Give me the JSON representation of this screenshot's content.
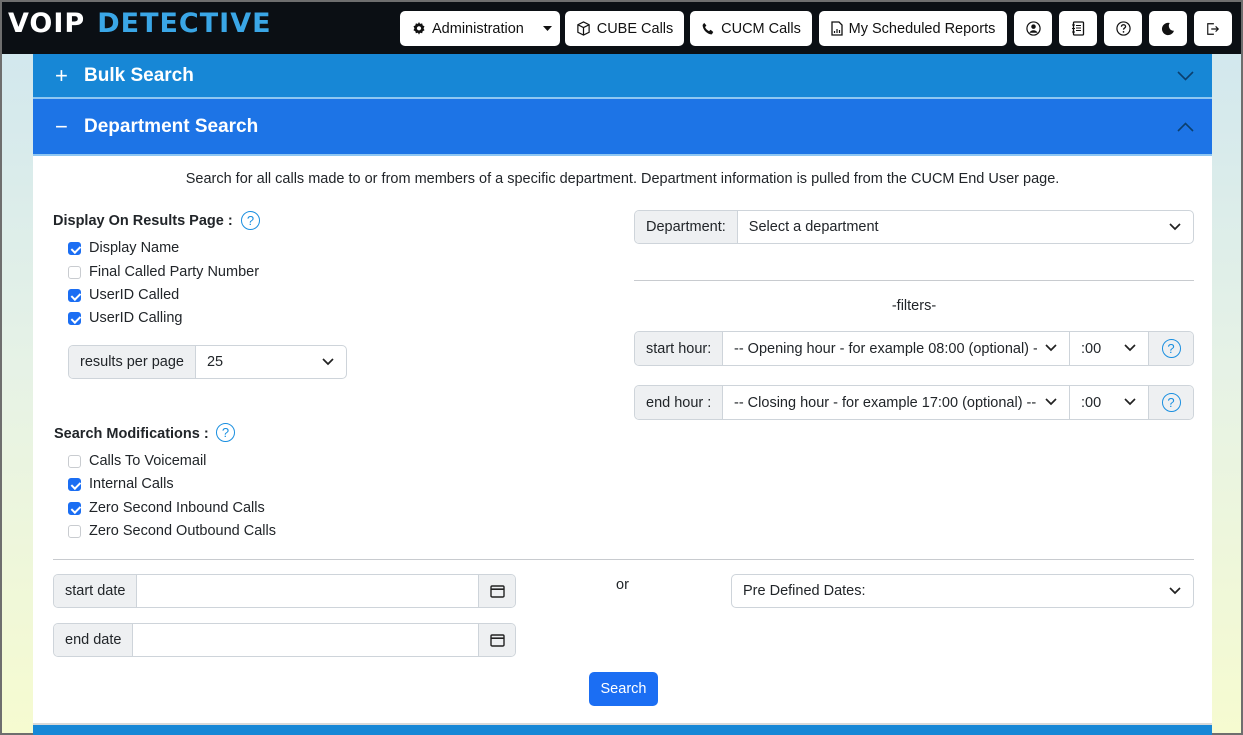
{
  "header": {
    "logo_part1": "VOIP",
    "logo_part2": "DETECTIVE",
    "admin_label": "Administration",
    "cube_label": "CUBE Calls",
    "cucm_label": "CUCM Calls",
    "reports_label": "My Scheduled Reports"
  },
  "accordion": {
    "bulk_sign": "+",
    "bulk_title": "Bulk Search",
    "dept_sign": "−",
    "dept_title": "Department Search"
  },
  "description": "Search for all calls made to or from members of a specific department. Department information is pulled from the CUCM End User page.",
  "display_section": {
    "label": "Display On Results Page :",
    "options": [
      {
        "label": "Display Name",
        "checked": true
      },
      {
        "label": "Final Called Party Number",
        "checked": false
      },
      {
        "label": "UserID Called",
        "checked": true
      },
      {
        "label": "UserID Calling",
        "checked": true
      }
    ],
    "results_label": "results per page",
    "results_value": "25"
  },
  "modifications_section": {
    "label": "Search Modifications :",
    "options": [
      {
        "label": "Calls To Voicemail",
        "checked": false
      },
      {
        "label": "Internal Calls",
        "checked": true
      },
      {
        "label": "Zero Second Inbound Calls",
        "checked": true
      },
      {
        "label": "Zero Second Outbound Calls",
        "checked": false
      }
    ]
  },
  "department": {
    "label": "Department:",
    "value": "Select a department"
  },
  "filters": {
    "title": "-filters-",
    "start_label": "start hour:",
    "start_value": "-- Opening hour - for example 08:00 (optional) --",
    "start_min": ":00",
    "end_label": "end hour :",
    "end_value": "-- Closing hour - for example 17:00 (optional) --",
    "end_min": ":00"
  },
  "dates": {
    "start_label": "start date",
    "end_label": "end date",
    "or_label": "or",
    "predefined": "Pre Defined Dates:"
  },
  "search_label": "Search",
  "help_glyph": "?",
  "colors": {
    "primary": "#1b6ef3",
    "accordion_bulk": "#1787d6",
    "accordion_active": "#1d74e6",
    "logo_accent": "#3aa6e6",
    "navbar": "#0b0f14"
  }
}
